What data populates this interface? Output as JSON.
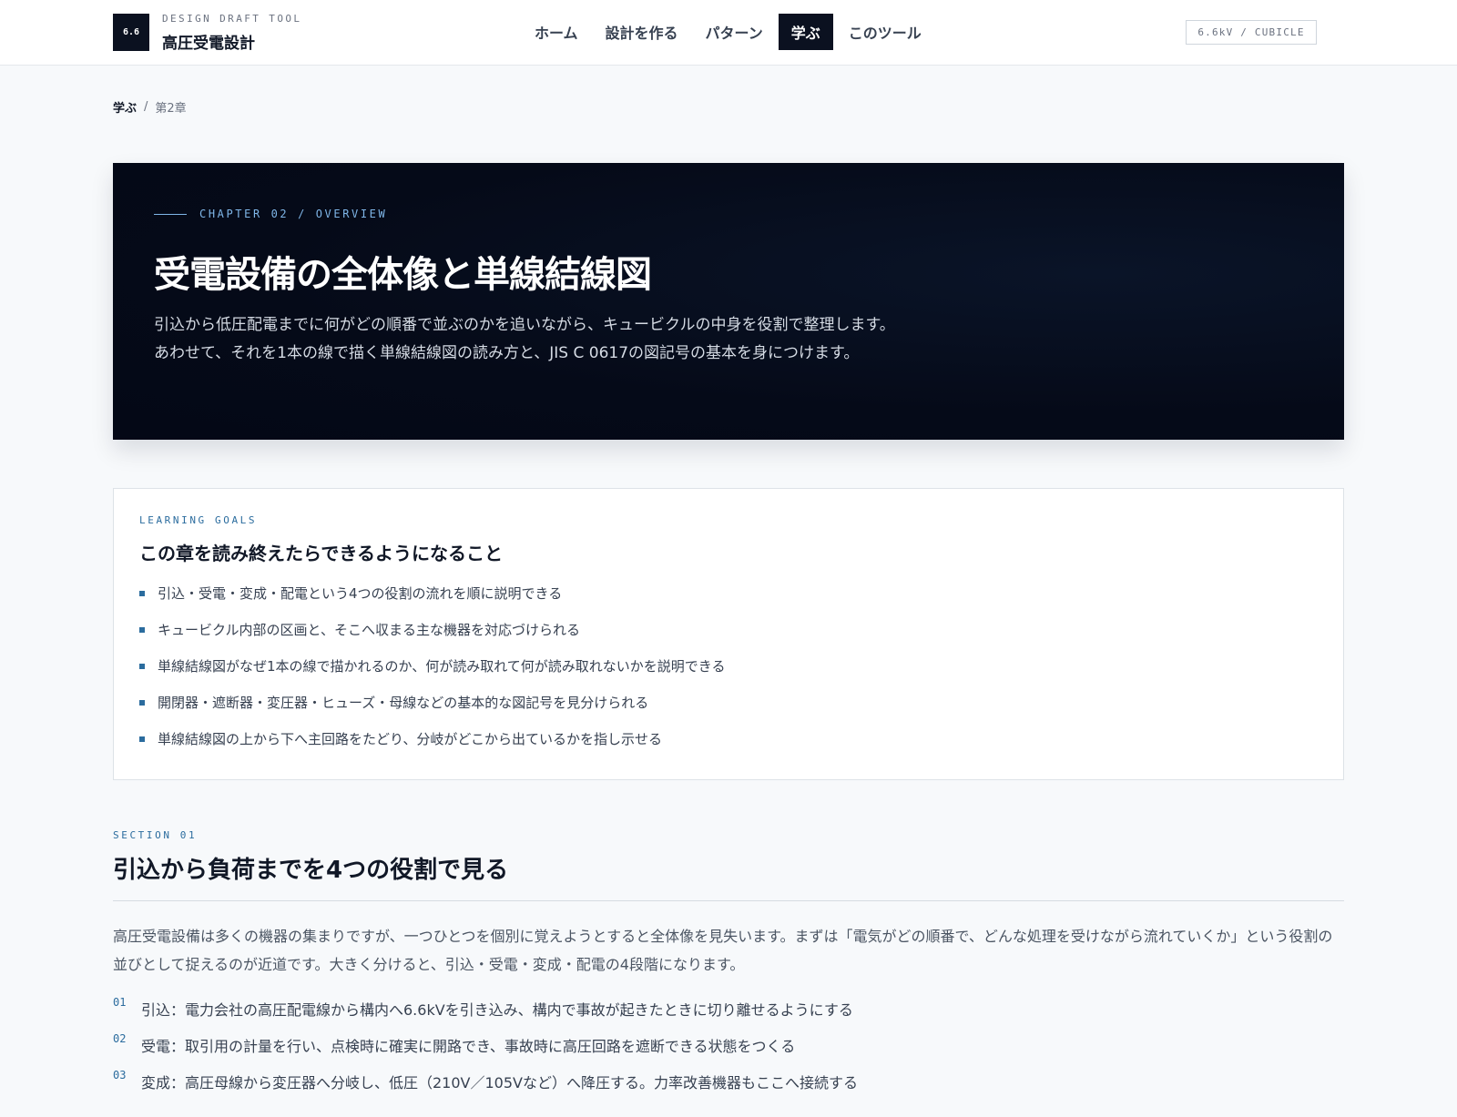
{
  "header": {
    "logo_text": "6.6",
    "brand_sub": "DESIGN DRAFT TOOL",
    "brand_title": "高圧受電設計",
    "nav": [
      {
        "label": "ホーム",
        "active": false
      },
      {
        "label": "設計を作る",
        "active": false
      },
      {
        "label": "パターン",
        "active": false
      },
      {
        "label": "学ぶ",
        "active": true
      },
      {
        "label": "このツール",
        "active": false
      }
    ],
    "version_badge": "6.6kV / CUBICLE"
  },
  "breadcrumb": {
    "parent": "学ぶ",
    "separator": "/",
    "current": "第2章"
  },
  "hero": {
    "eyebrow": "CHAPTER 02 / OVERVIEW",
    "title": "受電設備の全体像と単線結線図",
    "description": "引込から低圧配電までに何がどの順番で並ぶのかを追いながら、キュービクルの中身を役割で整理します。あわせて、それを1本の線で描く単線結線図の読み方と、JIS C 0617の図記号の基本を身につけます。"
  },
  "goals": {
    "eyebrow": "LEARNING GOALS",
    "title": "この章を読み終えたらできるようになること",
    "items": [
      "引込・受電・変成・配電という4つの役割の流れを順に説明できる",
      "キュービクル内部の区画と、そこへ収まる主な機器を対応づけられる",
      "単線結線図がなぜ1本の線で描かれるのか、何が読み取れて何が読み取れないかを説明できる",
      "開閉器・遮断器・変圧器・ヒューズ・母線などの基本的な図記号を見分けられる",
      "単線結線図の上から下へ主回路をたどり、分岐がどこから出ているかを指し示せる"
    ]
  },
  "section": {
    "eyebrow": "SECTION 01",
    "title": "引込から負荷までを4つの役割で見る",
    "body": "高圧受電設備は多くの機器の集まりですが、一つひとつを個別に覚えようとすると全体像を見失います。まずは「電気がどの順番で、どんな処理を受けながら流れていくか」という役割の並びとして捉えるのが近道です。大きく分けると、引込・受電・変成・配電の4段階になります。",
    "steps": [
      {
        "num": "01",
        "text": "引込：電力会社の高圧配電線から構内へ6.6kVを引き込み、構内で事故が起きたときに切り離せるようにする"
      },
      {
        "num": "02",
        "text": "受電：取引用の計量を行い、点検時に確実に開路でき、事故時に高圧回路を遮断できる状態をつくる"
      },
      {
        "num": "03",
        "text": "変成：高圧母線から変圧器へ分岐し、低圧（210V／105Vなど）へ降圧する。力率改善機器もここへ接続する"
      }
    ]
  }
}
